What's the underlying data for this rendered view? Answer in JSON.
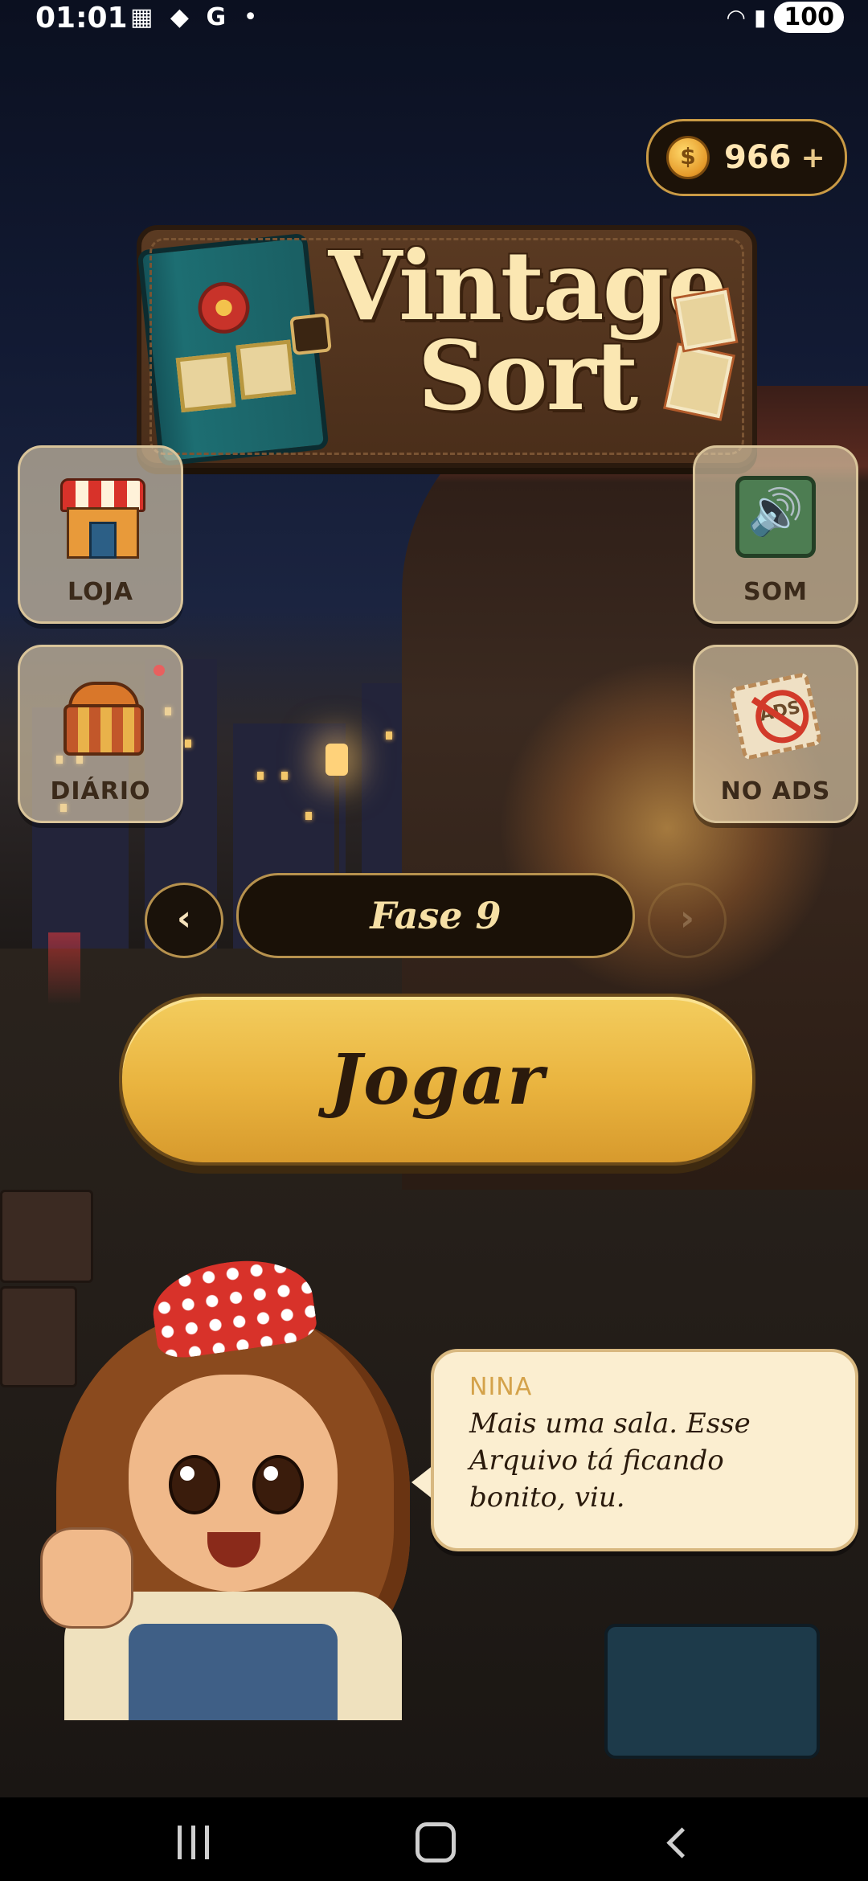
{
  "status_bar": {
    "time": "01:01",
    "battery": "100",
    "icons": [
      "calendar-icon",
      "shopping-bag-icon",
      "google-icon",
      "notification-dot-icon",
      "wifi-icon",
      "signal-icon"
    ]
  },
  "wallet": {
    "coins": "966",
    "plus_label": "+",
    "coin_symbol": "$"
  },
  "logo": {
    "line1": "Vintage",
    "line2": "Sort"
  },
  "menu": {
    "shop_label": "LOJA",
    "sound_label": "SOM",
    "diary_label": "DIÁRIO",
    "noads_label": "NO ADS",
    "ads_text": "ADS"
  },
  "level": {
    "label": "Fase 9",
    "prev": "‹",
    "next": "›"
  },
  "play": {
    "label": "Jogar"
  },
  "dialog": {
    "speaker": "NINA",
    "text": "Mais uma sala. Esse Arquivo tá ficando bonito, viu."
  },
  "colors": {
    "accent_gold": "#e9b33e",
    "panel_dark": "#1a1107",
    "tile_bg": "#e8d6b4",
    "bubble_bg": "#fbeed0",
    "notification_dot": "#e8605f"
  }
}
